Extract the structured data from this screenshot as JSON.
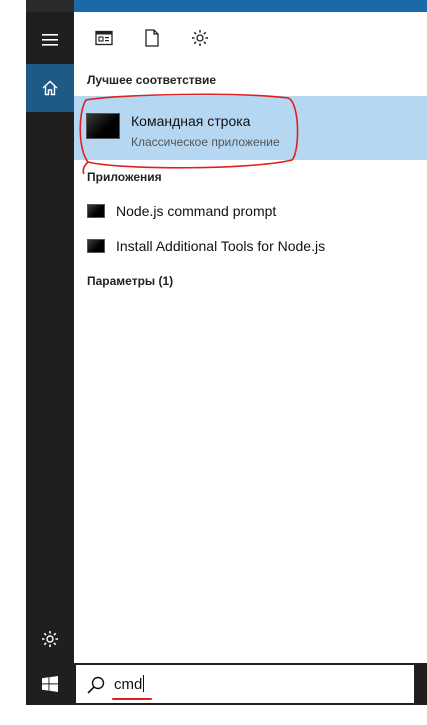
{
  "colors": {
    "rail": "#1f1f1f",
    "active_rail": "#1e5a86",
    "accent_strip": "#1b6aa8",
    "best_match_bg": "#b6d7f2",
    "annotation_red": "#e02020"
  },
  "rail": {
    "menu_icon": "hamburger-icon",
    "home_icon": "home-icon",
    "settings_icon": "gear-icon"
  },
  "filters": {
    "apps_icon": "app-window-icon",
    "documents_icon": "document-icon",
    "settings_icon": "gear-icon"
  },
  "sections": {
    "best_match": "Лучшее соответствие",
    "apps": "Приложения",
    "settings": "Параметры (1)"
  },
  "best_match": {
    "title": "Командная строка",
    "subtitle": "Классическое приложение",
    "icon": "cmd-icon"
  },
  "apps": [
    {
      "label": "Node.js command prompt",
      "icon": "cmd-icon"
    },
    {
      "label": "Install Additional Tools for Node.js",
      "icon": "cmd-icon"
    }
  ],
  "search": {
    "value": "cmd",
    "icon": "search-icon"
  },
  "taskbar": {
    "start_icon": "windows-logo-icon"
  }
}
